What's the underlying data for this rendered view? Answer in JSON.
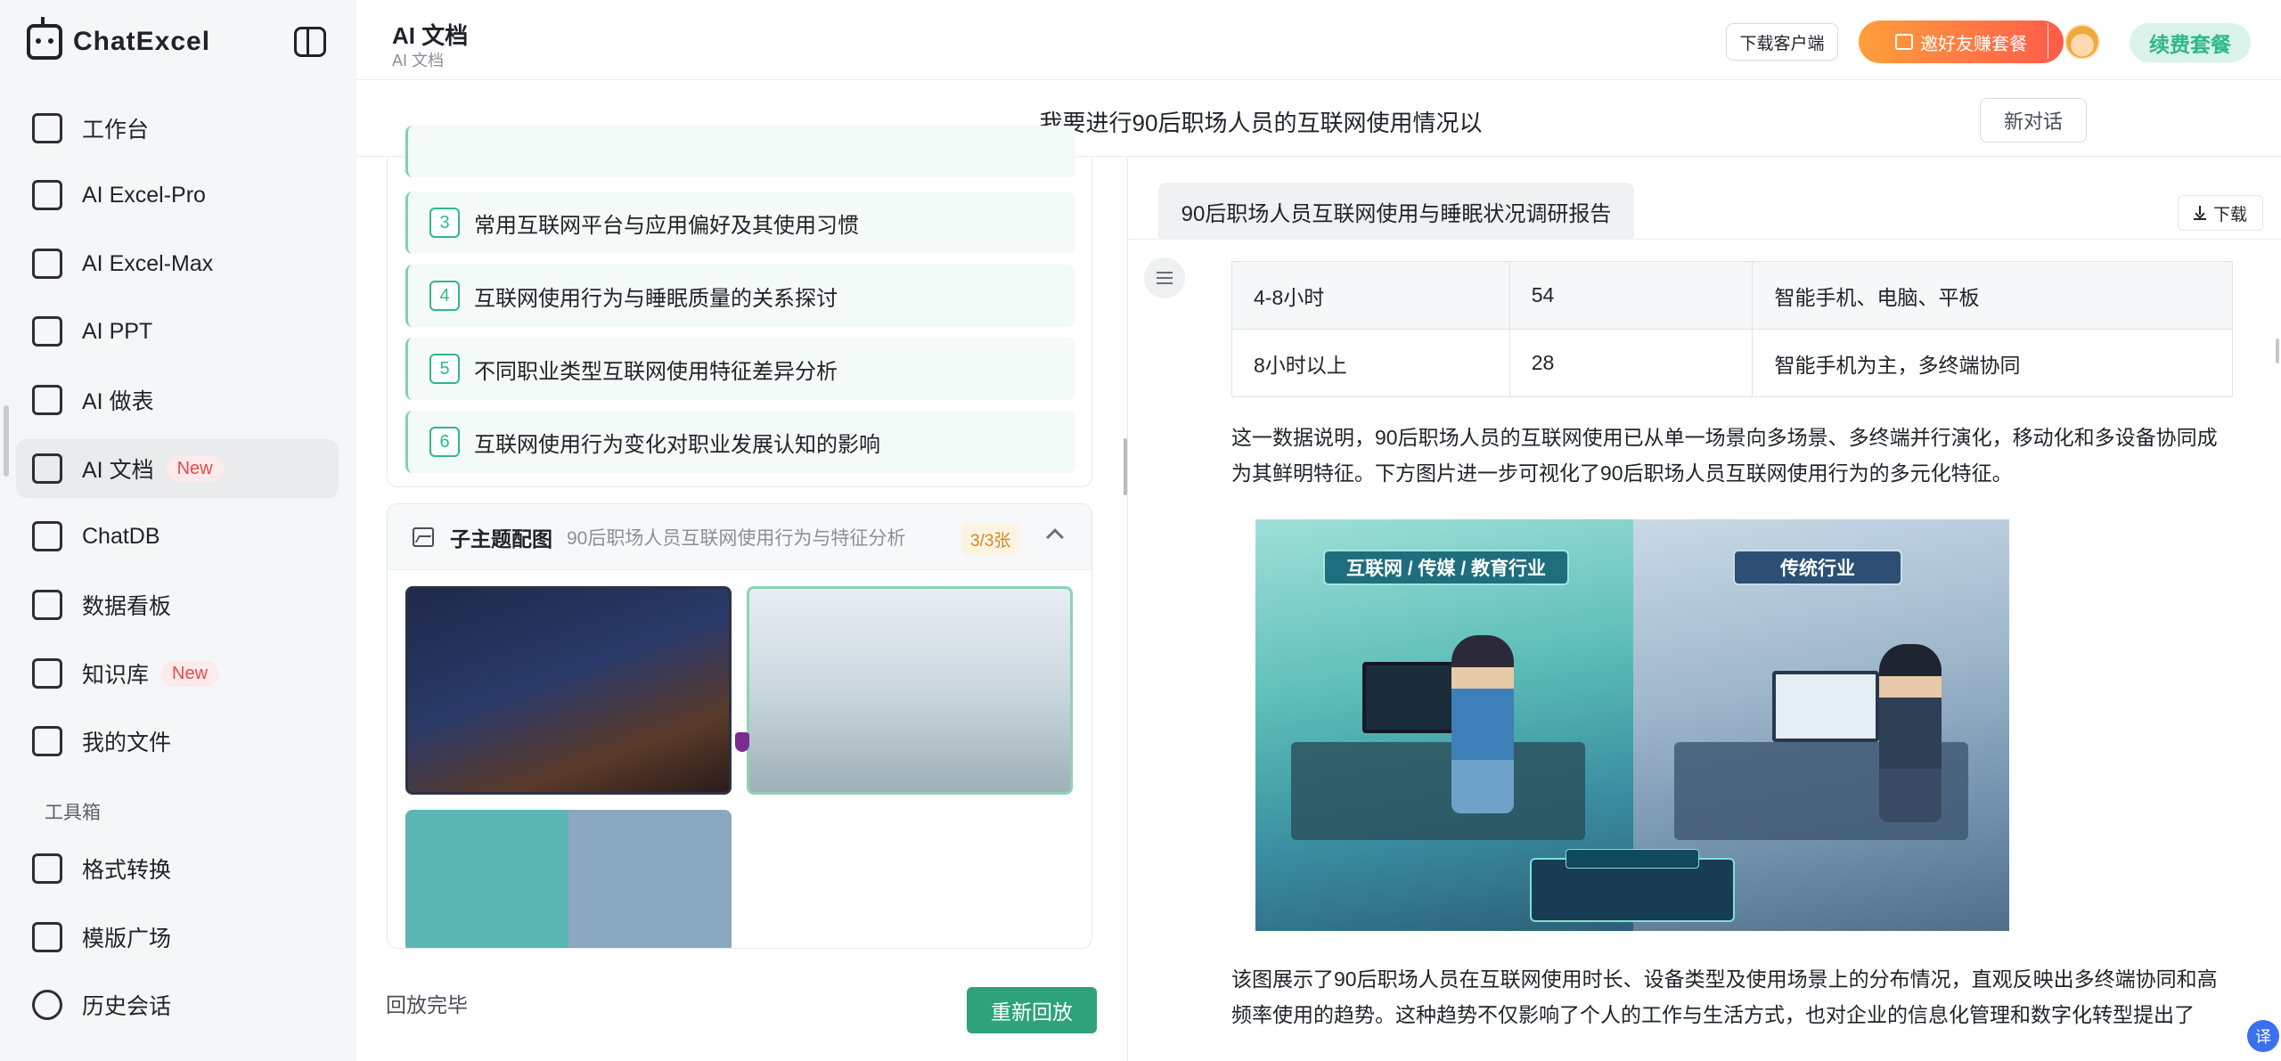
{
  "app": {
    "name": "ChatExcel"
  },
  "sidebar": {
    "items": [
      {
        "label": "工作台",
        "icon": "dashboard-grid-icon"
      },
      {
        "label": "AI Excel-Pro",
        "icon": "excel-pro-icon"
      },
      {
        "label": "AI Excel-Max",
        "icon": "excel-max-icon"
      },
      {
        "label": "AI PPT",
        "icon": "ppt-icon"
      },
      {
        "label": "AI 做表",
        "icon": "table-maker-icon"
      },
      {
        "label": "AI 文档",
        "icon": "document-icon",
        "badge": "New",
        "active": true
      },
      {
        "label": "ChatDB",
        "icon": "database-icon"
      },
      {
        "label": "数据看板",
        "icon": "chart-board-icon"
      },
      {
        "label": "知识库",
        "icon": "knowledge-book-icon",
        "badge": "New"
      },
      {
        "label": "我的文件",
        "icon": "folder-icon"
      }
    ],
    "toolbox_title": "工具箱",
    "tools": [
      {
        "label": "格式转换",
        "icon": "format-convert-icon"
      },
      {
        "label": "模版广场",
        "icon": "template-icon"
      },
      {
        "label": "历史会话",
        "icon": "history-clock-icon"
      }
    ]
  },
  "header": {
    "title": "AI 文档",
    "subtitle": "AI 文档",
    "download_client": "下载客户端",
    "invite": "邀好友赚套餐",
    "renew": "续费套餐"
  },
  "conversation": {
    "title": "我要进行90后职场人员的互联网使用情况以",
    "new_chat": "新对话"
  },
  "outline": {
    "items": [
      {
        "num": "3",
        "text": "常用互联网平台与应用偏好及其使用习惯"
      },
      {
        "num": "4",
        "text": "互联网使用行为与睡眠质量的关系探讨"
      },
      {
        "num": "5",
        "text": "不同职业类型互联网使用特征差异分析"
      },
      {
        "num": "6",
        "text": "互联网使用行为变化对职业发展认知的影响"
      }
    ]
  },
  "images_section": {
    "title": "子主题配图",
    "subtitle": "90后职场人员互联网使用行为与特征分析",
    "count": "3/3张"
  },
  "playback": {
    "status": "回放完毕",
    "replay": "重新回放"
  },
  "document": {
    "tab_title": "90后职场人员互联网使用与睡眠状况调研报告",
    "download": "下载",
    "table_rows": [
      {
        "c1": "4-8小时",
        "c2": "54",
        "c3": "智能手机、电脑、平板"
      },
      {
        "c1": "8小时以上",
        "c2": "28",
        "c3": "智能手机为主，多终端协同"
      }
    ],
    "para1": "这一数据说明，90后职场人员的互联网使用已从单一场景向多场景、多终端并行演化，移动化和多设备协同成为其鲜明特征。下方图片进一步可视化了90后职场人员互联网使用行为的多元化特征。",
    "figure": {
      "left_label": "互联网 / 传媒 / 教育行业",
      "right_label": "传统行业"
    },
    "para2": "该图展示了90后职场人员在互联网使用时长、设备类型及使用场景上的分布情况，直观反映出多终端协同和高频率使用的趋势。这种趋势不仅影响了个人的工作与生活方式，也对企业的信息化管理和数字化转型提出了"
  },
  "fab": {
    "translate": "译"
  },
  "colors": {
    "accent": "#2eb886",
    "invite_start": "#ff9f3a",
    "invite_end": "#ff5b4a"
  }
}
